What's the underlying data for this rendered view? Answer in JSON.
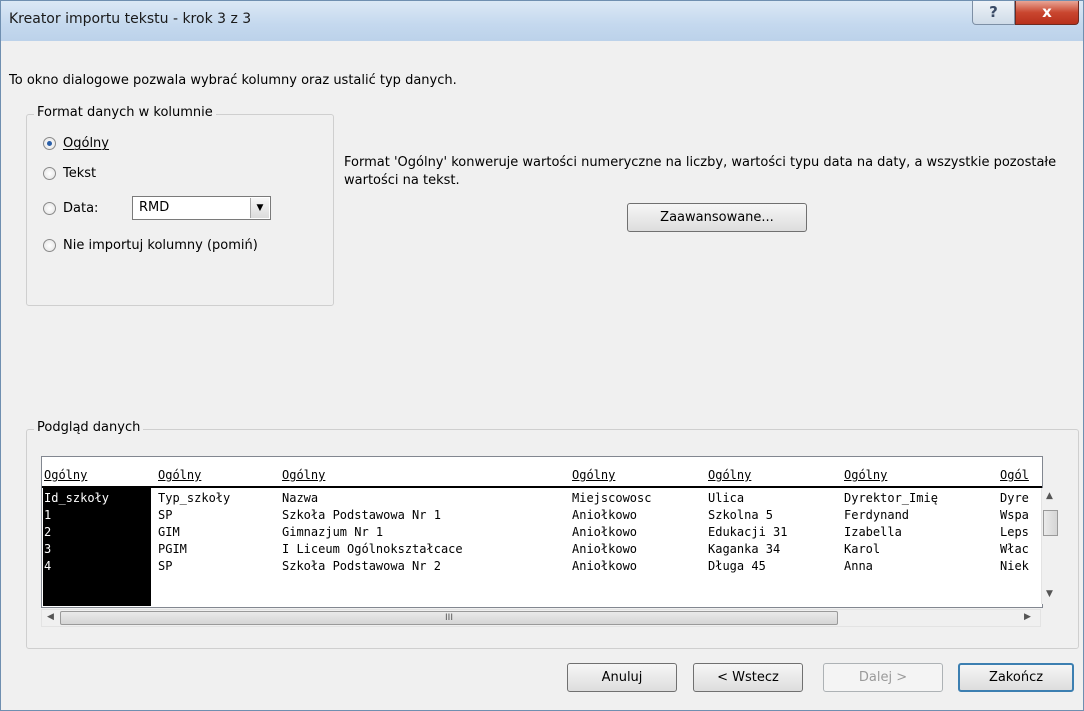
{
  "window": {
    "title": "Kreator importu tekstu - krok 3 z 3",
    "help_label": "?",
    "close_label": "x"
  },
  "description": "To okno dialogowe pozwala wybrać kolumny oraz ustalić typ danych.",
  "format_group": {
    "label": "Format danych w kolumnie",
    "options": [
      {
        "label": "Ogólny",
        "checked": true
      },
      {
        "label": "Tekst",
        "checked": false
      },
      {
        "label": "Data:",
        "checked": false
      },
      {
        "label": "Nie importuj kolumny (pomiń)",
        "checked": false
      }
    ],
    "date_format_value": "RMD"
  },
  "info_text": "Format 'Ogólny' konweruje wartości numeryczne na liczby, wartości typu data na daty, a wszystkie pozostałe wartości na tekst.",
  "advanced_button": "Zaawansowane...",
  "preview": {
    "label": "Podgląd danych",
    "headers": [
      "Ogólny",
      "Ogólny",
      "Ogólny",
      "Ogólny",
      "Ogólny",
      "Ogólny",
      "Ogól"
    ],
    "rows": [
      [
        "Id_szkoły",
        "Typ_szkoły",
        "Nazwa",
        "Miejscowosc",
        "Ulica",
        "Dyrektor_Imię",
        "Dyre"
      ],
      [
        "1",
        "SP",
        "Szkoła Podstawowa Nr 1",
        "Aniołkowo",
        "Szkolna 5",
        "Ferdynand",
        "Wspa"
      ],
      [
        "2",
        "GIM",
        "Gimnazjum Nr 1",
        "Aniołkowo",
        "Edukacji 31",
        "Izabella",
        "Leps"
      ],
      [
        "3",
        "PGIM",
        "I Liceum Ogólnokształcace",
        "Aniołkowo",
        "Kaganka 34",
        "Karol",
        "Włac"
      ],
      [
        "4",
        "SP",
        "Szkoła Podstawowa Nr 2",
        "Aniołkowo",
        "Długa 45",
        "Anna",
        "Niek"
      ]
    ],
    "hscroll_thumb_label": "III"
  },
  "buttons": {
    "cancel": "Anuluj",
    "back": "< Wstecz",
    "next": "Dalej >",
    "finish": "Zakończ"
  }
}
